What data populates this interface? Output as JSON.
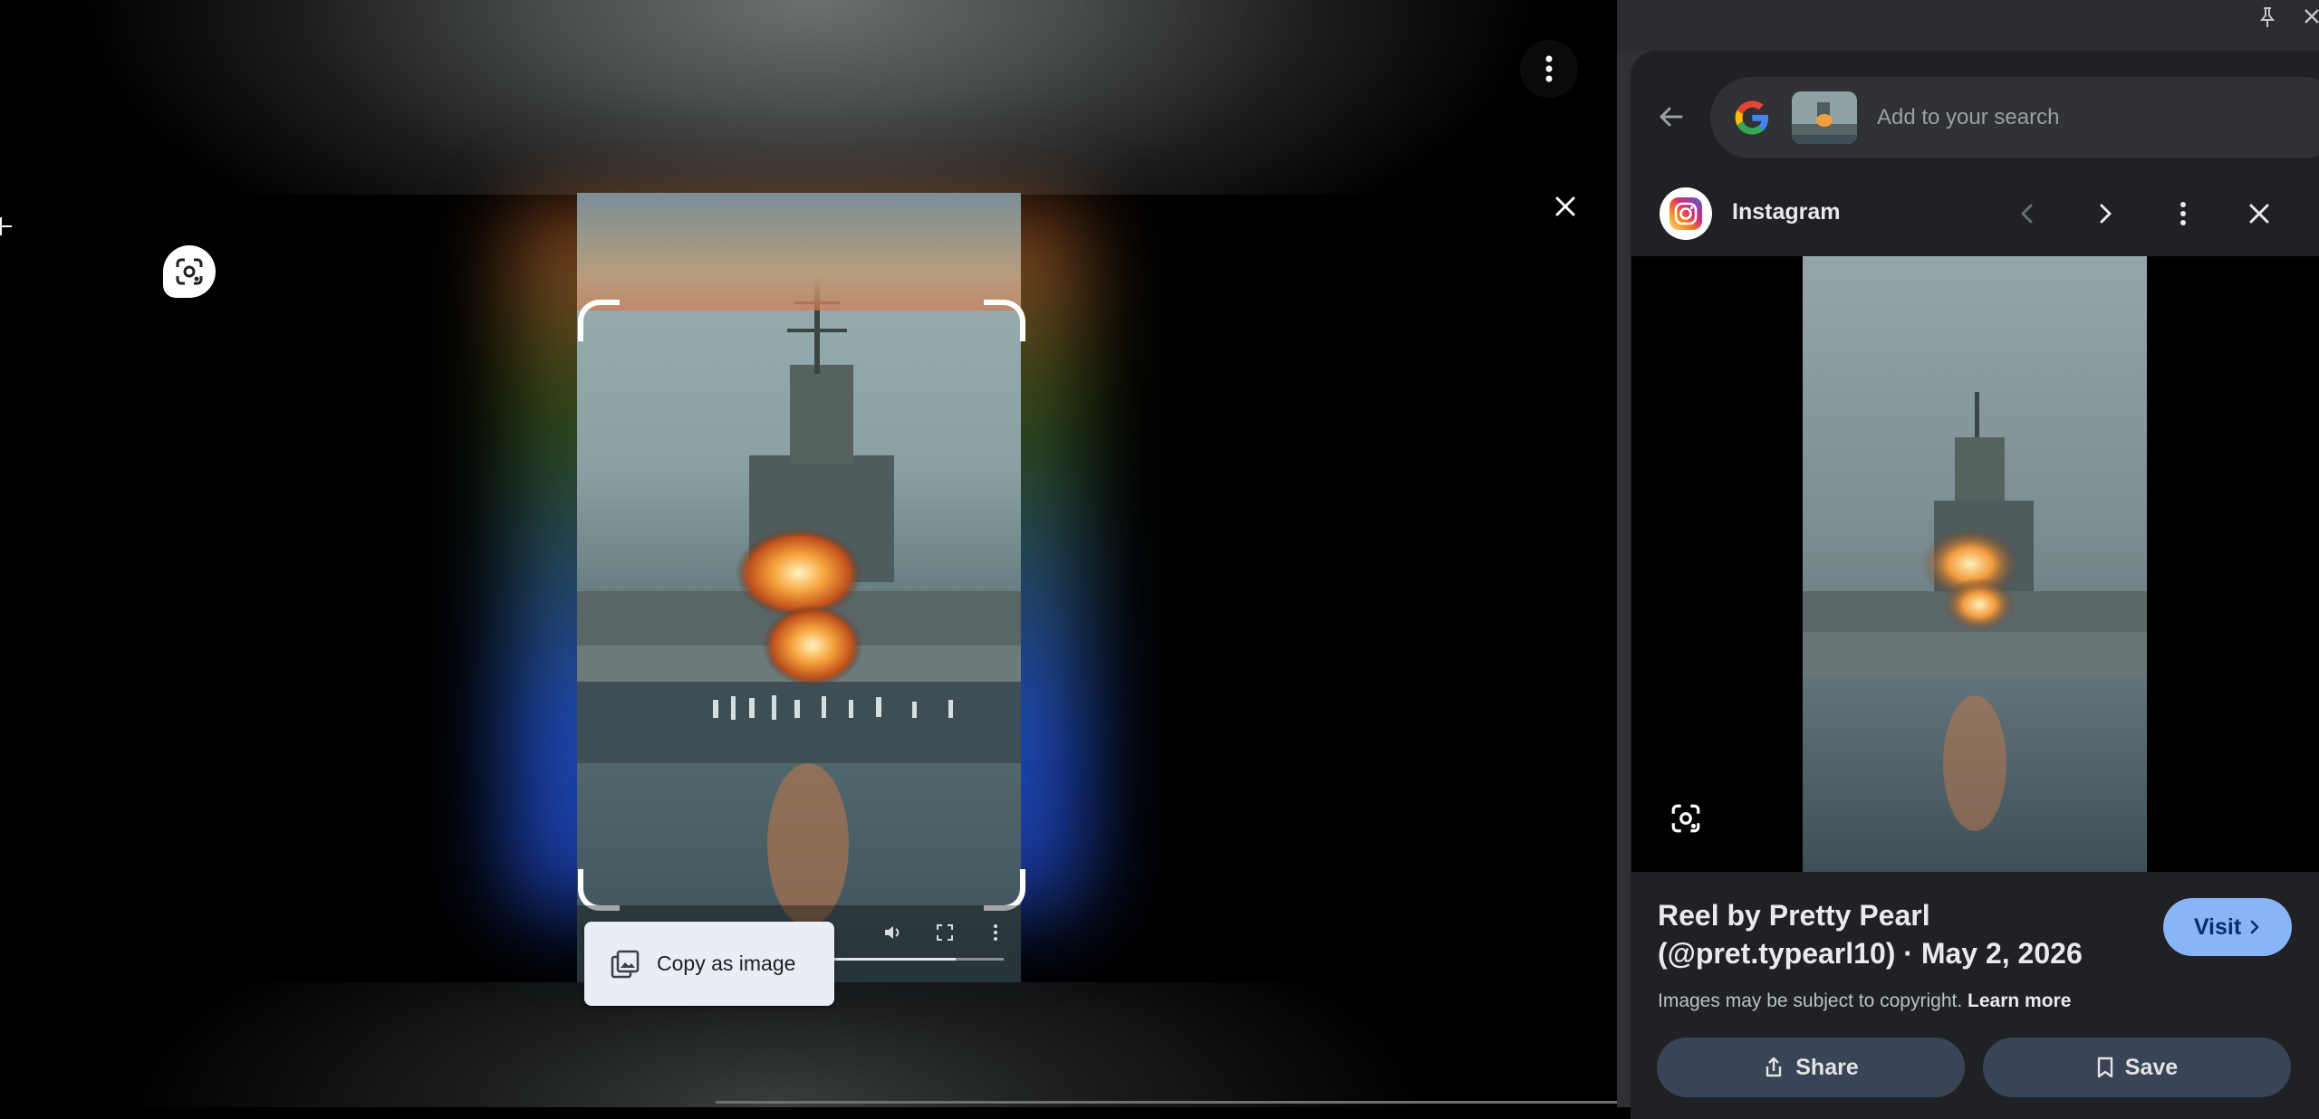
{
  "overlay": {
    "copy_tooltip_label": "Copy as image",
    "icons": {
      "menu": "more-vert-icon",
      "close": "close-icon",
      "lens": "lens-icon",
      "copy": "copy-image-icon",
      "volume": "volume-icon",
      "fullscreen": "fullscreen-icon",
      "video_menu": "more-vert-icon"
    },
    "video_progress": 0.72
  },
  "panel": {
    "search": {
      "placeholder": "Add to your search"
    },
    "source": {
      "name": "Instagram"
    },
    "result": {
      "title": "Reel by Pretty Pearl (@pret.typearl10) · May 2, 2026",
      "visit_label": "Visit",
      "copyright_text": "Images may be subject to copyright.",
      "learn_more_label": "Learn more",
      "share_label": "Share",
      "save_label": "Save"
    }
  },
  "colors": {
    "panel_bg": "#202124",
    "accent": "#8ab4f8",
    "action_button": "#394457"
  }
}
